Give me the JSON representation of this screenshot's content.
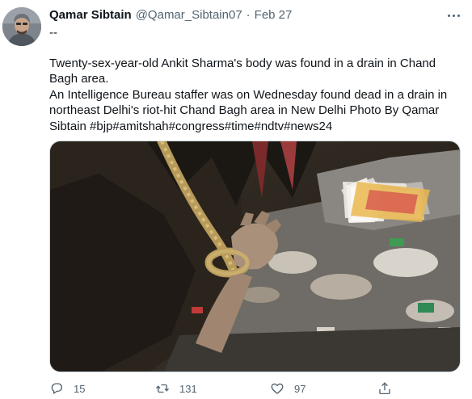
{
  "tweet": {
    "author_name": "Qamar Sibtain",
    "handle": "@Qamar_Sibtain07",
    "separator": "·",
    "date": "Feb 27",
    "line1": "--",
    "line2": "Twenty-sex-year-old Ankit Sharma's body was found in a drain in Chand Bagh area.",
    "line3": "An Intelligence Bureau staffer was on Wednesday found dead in a drain in northeast Delhi's riot-hit Chand Bagh area in New Delhi Photo By Qamar Sibtain #bjp#amitshah#congress#time#ndtv#news24"
  },
  "actions": {
    "reply_count": "15",
    "retweet_count": "131",
    "like_count": "97"
  },
  "icons": {
    "more": "more-horizontal-icon",
    "reply": "reply-icon",
    "retweet": "retweet-icon",
    "like": "heart-icon",
    "share": "share-icon"
  },
  "colors": {
    "text": "#0f1419",
    "secondary": "#536471",
    "border": "#cfd9de"
  }
}
